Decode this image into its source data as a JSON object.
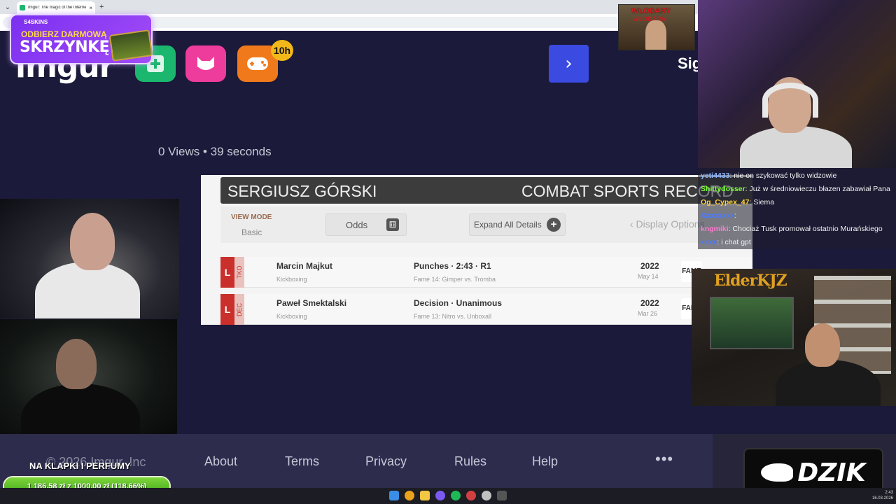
{
  "browser": {
    "tab_title": "Imgur: The magic of the Internet",
    "tab_close": "×",
    "new_tab": "+",
    "tab_menu": "⌄"
  },
  "imgur": {
    "logo": "imgur",
    "badge": "10h",
    "next_glyph": "›",
    "signin": "Sign In",
    "views": "0 Views",
    "separator": "•",
    "duration": "39 seconds"
  },
  "promo": {
    "brand": "S4SKINS",
    "line1": "ODBIERZ DARMOWĄ",
    "line2": "SKRZYNKĘ!"
  },
  "record": {
    "fighter": "SERGIUSZ GÓRSKI",
    "section": "COMBAT SPORTS RECORD",
    "view_mode_label": "VIEW MODE",
    "view_mode_value": "Basic",
    "odds_label": "Odds",
    "expand_label": "Expand All Details",
    "expand_icon": "+",
    "display_label": "‹ Display Options",
    "fights": [
      {
        "result": "L",
        "method": "TKO",
        "opponent": "Marcin Majkut",
        "sport": "Kickboxing",
        "result_detail": "Punches · 2:43 · R1",
        "event": "Fame 14: Gimper vs. Tromba",
        "year": "2022",
        "date": "May 14",
        "org": "FAME"
      },
      {
        "result": "L",
        "method": "DEC",
        "opponent": "Paweł Smektalski",
        "sport": "Kickboxing",
        "result_detail": "Decision · Unanimous",
        "event": "Fame 13: Nitro vs. Unboxall",
        "year": "2022",
        "date": "Mar 26",
        "org": "FAME"
      }
    ]
  },
  "overlay": {
    "poster_title": "WŁODARY",
    "poster_sub": "WŁODARA",
    "elder_logo": "ElderKJZ"
  },
  "chat": {
    "messages": [
      {
        "user": "yeti4433",
        "text": "nie on szykować tylko widzowie",
        "color": "#8fb8ff"
      },
      {
        "user": "Shittydosser",
        "text": "Już w średniowieczu błazen zabawiał Pana",
        "color": "#7dff3a"
      },
      {
        "user": "Og_Cypex_47",
        "text": "Siema",
        "color": "#ffd23a"
      },
      {
        "user": "Xxxxxxxx",
        "text": "",
        "color": "#4a7aff"
      },
      {
        "user": "kngmiki",
        "text": "Chociaż Tusk promował ostatnio Murańskiego",
        "color": "#ff7ad0"
      },
      {
        "user": "xxxx",
        "text": "i chat gpt",
        "color": "#4a7aff"
      }
    ]
  },
  "footer": {
    "copyright": "© 2026 Imgur, Inc",
    "links": [
      "About",
      "Terms",
      "Privacy",
      "Rules",
      "Help"
    ],
    "more": "•••"
  },
  "goal": {
    "label": "NA KLAPKI I PERFUMY",
    "text": "1 186,58 zł  z  1000,00 zł (118.66%)",
    "progress": 1.0
  },
  "dzik": {
    "text": "DZIK"
  },
  "taskbar": {
    "time": "2:43",
    "date": "16.03.2026"
  }
}
